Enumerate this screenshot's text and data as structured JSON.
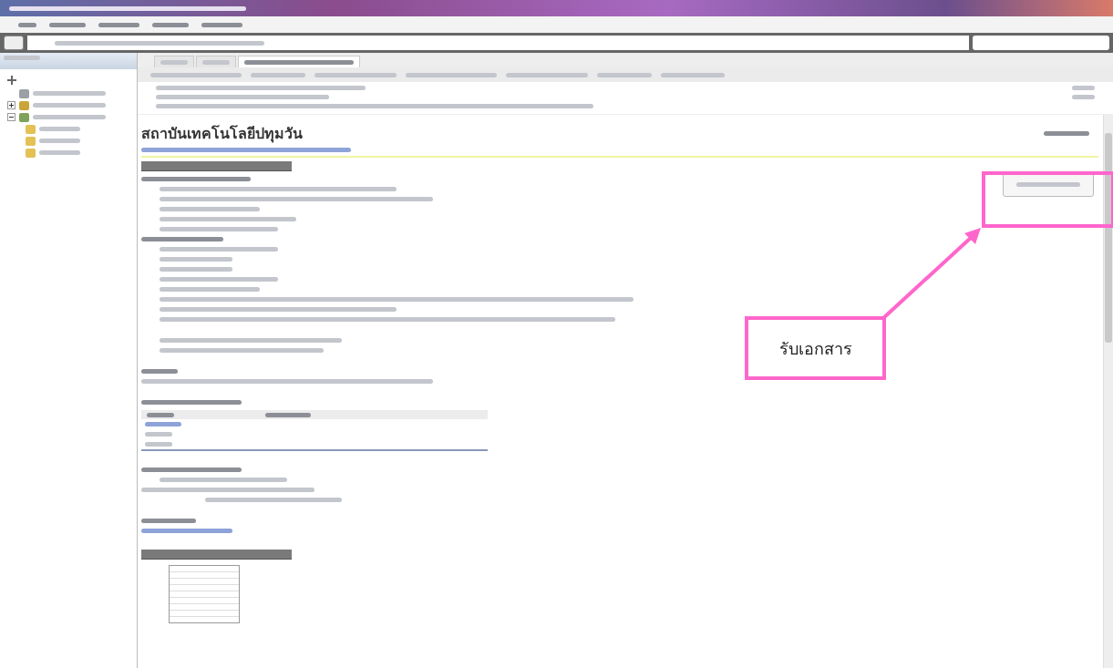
{
  "tree": [
    {
      "kind": "home"
    },
    {
      "kind": "user",
      "expanded": false
    },
    {
      "kind": "group",
      "expanded": true,
      "children": [
        {
          "kind": "folder"
        },
        {
          "kind": "folder"
        },
        {
          "kind": "folder"
        }
      ]
    }
  ],
  "tabs": [
    {
      "selected": false
    },
    {
      "selected": false
    },
    {
      "selected": true
    }
  ],
  "heading": "สถาบันเทคโนโลยีปทุมวัน",
  "annotation": {
    "label": "รับเอกสาร"
  }
}
